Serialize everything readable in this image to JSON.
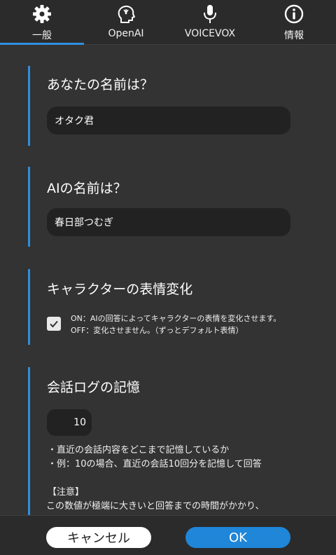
{
  "tabs": [
    {
      "label": "一般",
      "icon": "gear-icon"
    },
    {
      "label": "OpenAI",
      "icon": "ai-head-icon"
    },
    {
      "label": "VOICEVOX",
      "icon": "microphone-icon"
    },
    {
      "label": "情報",
      "icon": "info-icon"
    }
  ],
  "accent": "#2f8fe0",
  "sections": {
    "user_name": {
      "title": "あなたの名前は？",
      "value": "オタク君"
    },
    "ai_name": {
      "title": "AIの名前は？",
      "value": "春日部つむぎ"
    },
    "expression": {
      "title": "キャラクターの表情変化",
      "checked": true,
      "desc_on": "ON：AIの回答によってキャラクターの表情を変化させます。",
      "desc_off": "OFF：変化させません。（ずっとデフォルト表情）"
    },
    "memory": {
      "title": "会話ログの記憶",
      "value": "10",
      "note1": "・直近の会話内容をどこまで記憶しているか",
      "note2": "・例：10の場合、直近の会話10回分を記憶して回答",
      "caution_title": "【注意】",
      "caution_text": "この数値が極端に大きいと回答までの時間がかかり、"
    }
  },
  "buttons": {
    "cancel": "キャンセル",
    "ok": "OK"
  }
}
